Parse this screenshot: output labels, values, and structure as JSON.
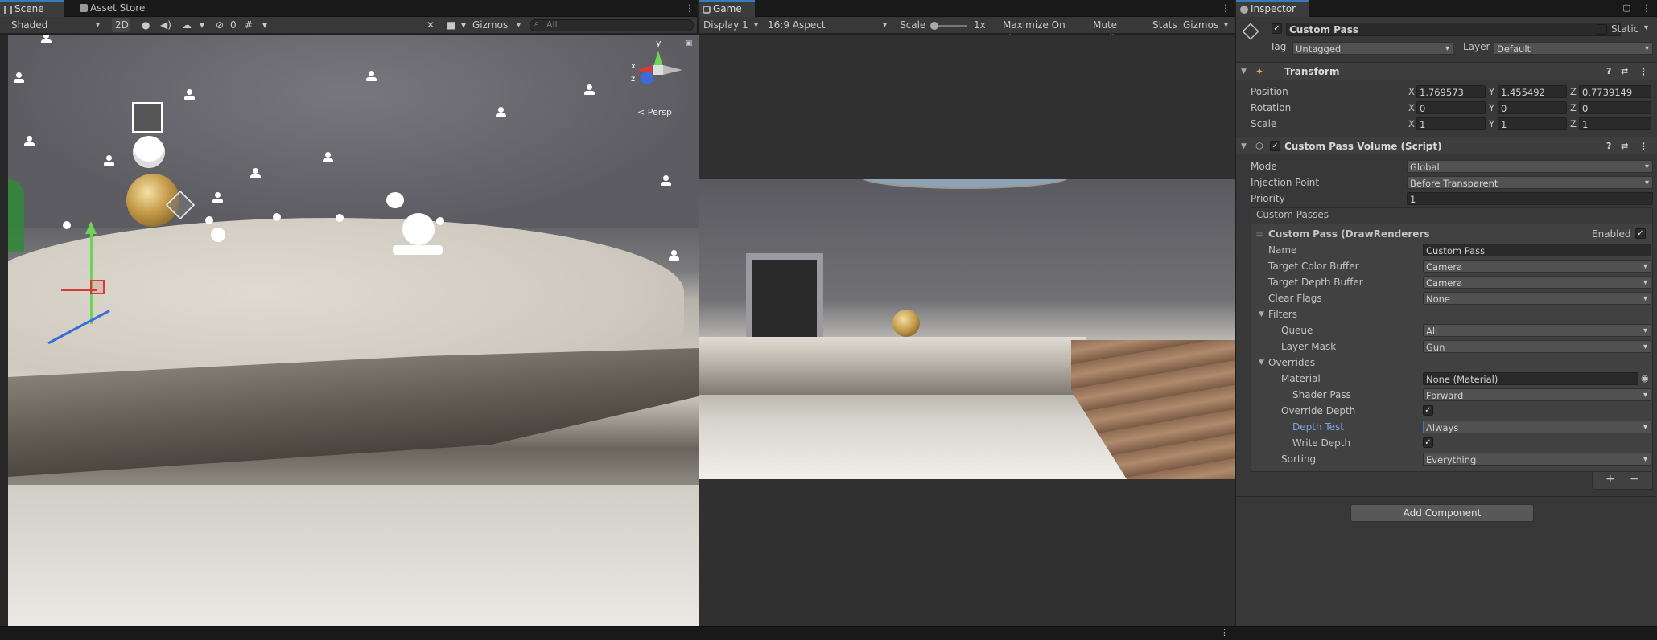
{
  "scene_tabs": {
    "scene": "Scene",
    "asset_store": "Asset Store"
  },
  "scene_toolbar": {
    "shading": "Shaded",
    "mode_2d": "2D",
    "hidden_count": "0",
    "gizmos": "Gizmos",
    "search_placeholder": "All",
    "persp": "< Persp",
    "axis_y": "y",
    "axis_x": "x",
    "axis_z": "z"
  },
  "game_tab": "Game",
  "game_toolbar": {
    "display": "Display 1",
    "aspect": "16:9 Aspect",
    "scale_label": "Scale",
    "scale_value": "1x",
    "maximize": "Maximize On Play",
    "mute": "Mute Audio",
    "stats": "Stats",
    "gizmos": "Gizmos"
  },
  "inspector_tab": "Inspector",
  "object": {
    "name": "Custom Pass",
    "static_label": "Static",
    "tag_label": "Tag",
    "tag_value": "Untagged",
    "layer_label": "Layer",
    "layer_value": "Default"
  },
  "transform": {
    "title": "Transform",
    "position_label": "Position",
    "rotation_label": "Rotation",
    "scale_label": "Scale",
    "position": {
      "x": "1.769573",
      "y": "1.455492",
      "z": "0.7739149"
    },
    "rotation": {
      "x": "0",
      "y": "0",
      "z": "0"
    },
    "scale": {
      "x": "1",
      "y": "1",
      "z": "1"
    },
    "axis_x": "X",
    "axis_y": "Y",
    "axis_z": "Z"
  },
  "volume": {
    "title": "Custom Pass Volume (Script)",
    "mode_label": "Mode",
    "mode_value": "Global",
    "injection_label": "Injection Point",
    "injection_value": "Before Transparent",
    "priority_label": "Priority",
    "priority_value": "1",
    "passes_label": "Custom Passes"
  },
  "pass": {
    "title": "Custom Pass (DrawRenderersCu",
    "enabled_label": "Enabled",
    "name_label": "Name",
    "name_value": "Custom Pass",
    "color_label": "Target Color Buffer",
    "color_value": "Camera",
    "depth_label": "Target Depth Buffer",
    "depth_value": "Camera",
    "clear_label": "Clear Flags",
    "clear_value": "None",
    "filters_label": "Filters",
    "queue_label": "Queue",
    "queue_value": "All",
    "mask_label": "Layer Mask",
    "mask_value": "Gun",
    "overrides_label": "Overrides",
    "material_label": "Material",
    "material_value": "None (Material)",
    "shader_label": "Shader Pass",
    "shader_value": "Forward",
    "override_depth_label": "Override Depth",
    "depth_test_label": "Depth Test",
    "depth_test_value": "Always",
    "write_depth_label": "Write Depth",
    "sorting_label": "Sorting",
    "sorting_value": "Everything"
  },
  "add_component": "Add Component",
  "list_add": "+",
  "list_remove": "−",
  "colors": {
    "accent": "#3a79bb",
    "panel": "#383838",
    "dark": "#191919",
    "highlight_label": "#7ea7e0"
  }
}
